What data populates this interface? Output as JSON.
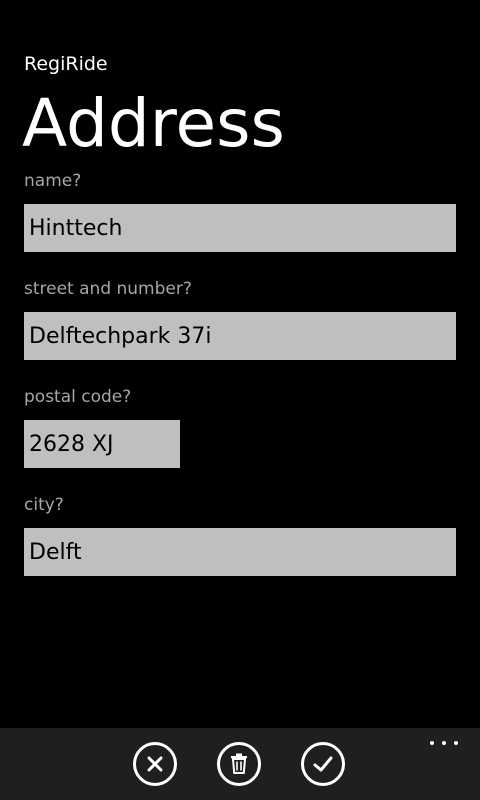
{
  "header": {
    "app_title": "RegiRide",
    "page_title": "Address"
  },
  "form": {
    "name": {
      "label": "name?",
      "value": "Hinttech"
    },
    "street": {
      "label": "street and number?",
      "value": "Delftechpark 37i"
    },
    "postal_code": {
      "label": "postal code?",
      "value": "2628 XJ"
    },
    "city": {
      "label": "city?",
      "value": "Delft"
    }
  },
  "appbar": {
    "buttons": [
      {
        "icon": "cancel-icon"
      },
      {
        "icon": "delete-icon"
      },
      {
        "icon": "check-icon"
      }
    ],
    "more_icon": "ellipsis-icon"
  },
  "colors": {
    "background": "#000000",
    "input_background": "#bfbfbf",
    "label_text": "#a6a6a6",
    "appbar_background": "#1f1f1f"
  }
}
